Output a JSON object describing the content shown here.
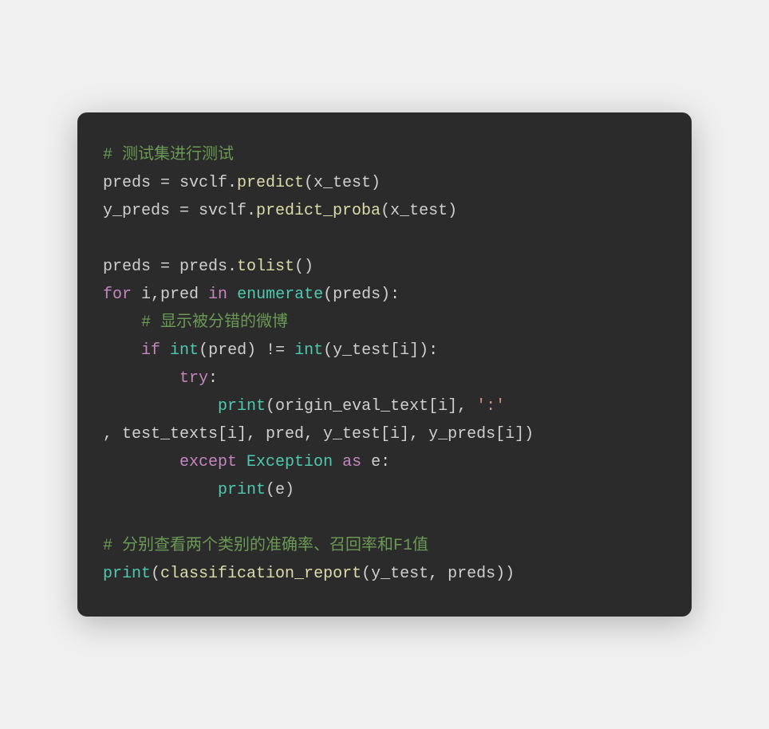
{
  "code": {
    "line1_comment": "# 测试集进行测试",
    "line2_a": "preds = svclf.",
    "line2_b": "predict",
    "line2_c": "(x_test)",
    "line3_a": "y_preds = svclf.",
    "line3_b": "predict_proba",
    "line3_c": "(x_test)",
    "line4": "",
    "line5_a": "preds = preds.",
    "line5_b": "tolist",
    "line5_c": "()",
    "line6_for": "for",
    "line6_a": " i,pred ",
    "line6_in": "in",
    "line6_sp": " ",
    "line6_enum": "enumerate",
    "line6_c": "(preds):",
    "line7_indent": "    ",
    "line7_comment": "# 显示被分错的微博",
    "line8_indent": "    ",
    "line8_if": "if",
    "line8_sp1": " ",
    "line8_int1": "int",
    "line8_a": "(pred) != ",
    "line8_int2": "int",
    "line8_b": "(y_test[i]):",
    "line9_indent": "        ",
    "line9_try": "try",
    "line9_colon": ":",
    "line10_indent": "            ",
    "line10_print": "print",
    "line10_a": "(origin_eval_text[i], ",
    "line10_str": "':'",
    "line11_a": ", test_texts[i], pred, y_test[i], y_preds[i])",
    "line12_indent": "        ",
    "line12_except": "except",
    "line12_sp": " ",
    "line12_exc": "Exception",
    "line12_sp2": " ",
    "line12_as": "as",
    "line12_e": " e:",
    "line13_indent": "            ",
    "line13_print": "print",
    "line13_a": "(e)",
    "line14": "",
    "line15_comment": "# 分别查看两个类别的准确率、召回率和F1值",
    "line16_print": "print",
    "line16_a": "(",
    "line16_b": "classification_report",
    "line16_c": "(y_test, preds))"
  }
}
